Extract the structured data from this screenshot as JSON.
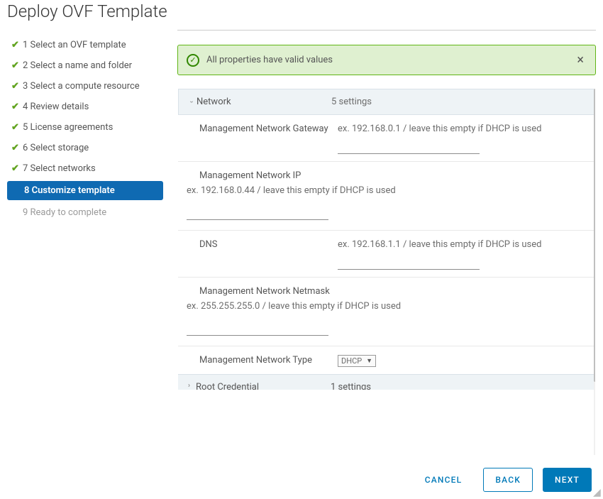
{
  "title": "Deploy OVF Template",
  "steps": [
    {
      "label": "1 Select an OVF template",
      "state": "done"
    },
    {
      "label": "2 Select a name and folder",
      "state": "done"
    },
    {
      "label": "3 Select a compute resource",
      "state": "done"
    },
    {
      "label": "4 Review details",
      "state": "done"
    },
    {
      "label": "5 License agreements",
      "state": "done"
    },
    {
      "label": "6 Select storage",
      "state": "done"
    },
    {
      "label": "7 Select networks",
      "state": "done"
    },
    {
      "label": "8 Customize template",
      "state": "active"
    },
    {
      "label": "9 Ready to complete",
      "state": "pending"
    }
  ],
  "alert": {
    "text": "All properties have valid values"
  },
  "section_network": {
    "title": "Network",
    "count": "5 settings"
  },
  "props": {
    "gateway": {
      "label": "Management Network Gateway",
      "help": "ex. 192.168.0.1 / leave this empty if DHCP is used"
    },
    "ip": {
      "label": "Management Network IP",
      "help": "ex. 192.168.0.44 / leave this empty if DHCP is used"
    },
    "dns": {
      "label": "DNS",
      "help": "ex. 192.168.1.1 / leave this empty if DHCP is used"
    },
    "netmask": {
      "label": "Management Network Netmask",
      "help": "ex. 255.255.255.0 / leave this empty if DHCP is used"
    },
    "nettype": {
      "label": "Management Network Type",
      "value": "DHCP"
    }
  },
  "section_root": {
    "title": "Root Credential",
    "count": "1 settings"
  },
  "footer": {
    "cancel": "CANCEL",
    "back": "BACK",
    "next": "NEXT"
  }
}
